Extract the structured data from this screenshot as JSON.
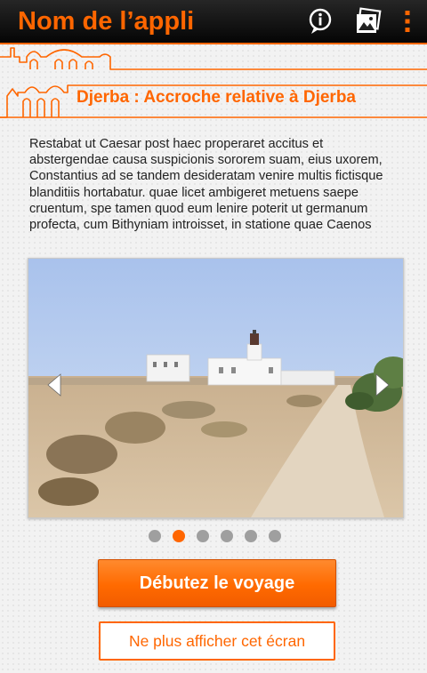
{
  "app": {
    "title": "Nom de l’appli",
    "icons": [
      "info-icon",
      "gallery-icon",
      "overflow-menu-icon"
    ]
  },
  "banner": {
    "title": "Djerba : Accroche relative à Djerba"
  },
  "description": "Restabat ut Caesar post haec properaret accitus et abstergendae causa suspicionis sororem suam, eius uxorem, Constantius ad se tandem desideratam venire multis fictisque blanditiis hortabatur. quae licet ambigeret metuens saepe cruentum, spe tamen quod eum lenire poterit ut germanum profecta, cum Bithyniam introisset, in statione quae Caenos",
  "carousel": {
    "image": "lighthouse-beach-photo",
    "slide_count": 6,
    "active_index": 1,
    "prev_icon": "chevron-left-icon",
    "next_icon": "chevron-right-icon"
  },
  "actions": {
    "start_label": "Débutez le voyage",
    "skip_label": "Ne plus afficher cet écran"
  },
  "colors": {
    "accent": "#ff6600",
    "topbar": "#111111",
    "background": "#f2f2f2",
    "dot_inactive": "#9f9f9f"
  }
}
